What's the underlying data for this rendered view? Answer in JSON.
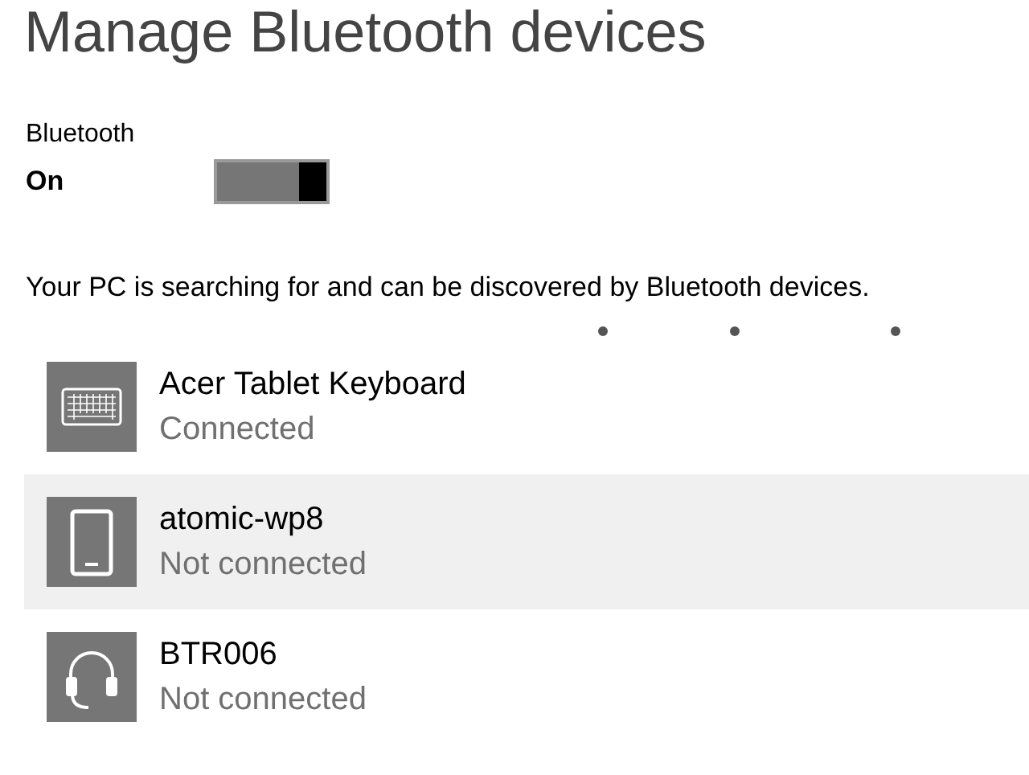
{
  "title": "Manage Bluetooth devices",
  "bluetooth": {
    "label": "Bluetooth",
    "state": "On",
    "on": true
  },
  "status": "Your PC is searching for and can be discovered by Bluetooth devices.",
  "devices": [
    {
      "kind": "keyboard",
      "name": "Acer Tablet Keyboard",
      "status": "Connected",
      "selected": false
    },
    {
      "kind": "phone",
      "name": "atomic-wp8",
      "status": "Not connected",
      "selected": true
    },
    {
      "kind": "headset",
      "name": "BTR006",
      "status": "Not connected",
      "selected": false
    }
  ]
}
